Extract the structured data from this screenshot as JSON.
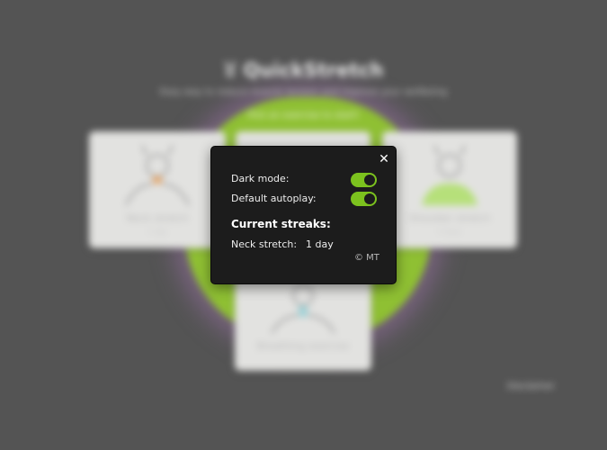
{
  "app": {
    "name": "QuickStretch",
    "tagline": "Easy way to reduce muscle tension and improve your wellbeing",
    "prompt": "Pick an exercise to start!",
    "disclaimer": "Disclaimer"
  },
  "exercises": [
    {
      "title": "Neck stretch",
      "subtitle": "1 day",
      "accent": "#e8a86a"
    },
    {
      "title": "",
      "subtitle": "",
      "accent": "#cfcfcf"
    },
    {
      "title": "Shoulder stretch",
      "subtitle": "0 days",
      "accent": "#b6e07a"
    },
    {
      "title": "Breathing exercise",
      "subtitle": "",
      "accent": "#9fd3d8"
    }
  ],
  "settings": {
    "dark_mode_label": "Dark mode:",
    "dark_mode_on": true,
    "autoplay_label": "Default autoplay:",
    "autoplay_on": true,
    "streaks_heading": "Current streaks:",
    "streaks": [
      {
        "name": "Neck stretch:",
        "value": "1 day"
      }
    ],
    "copyright": "© MT",
    "close_icon": "close-icon"
  },
  "colors": {
    "toggle_on": "#7cc21e",
    "modal_bg": "#1c1c1c",
    "backdrop": "#545454",
    "glow": "#8fc033"
  }
}
